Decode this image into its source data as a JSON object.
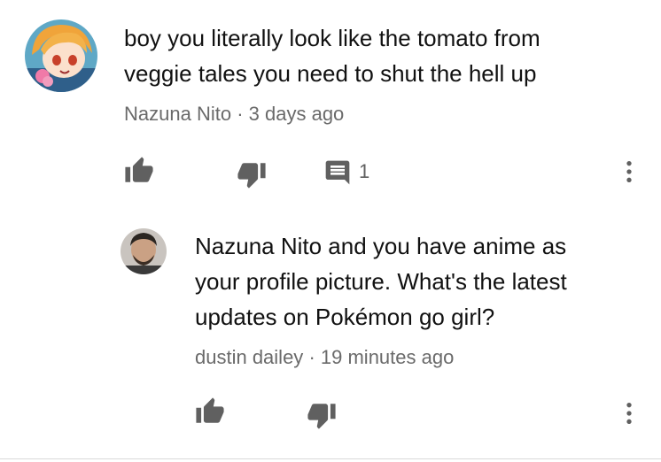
{
  "comment": {
    "text_line1": "boy you literally look like the tomato from",
    "text_line2": "veggie tales you need to shut the hell up",
    "author": "Nazuna Nito",
    "separator": "·",
    "time": "3 days ago",
    "reply_count": "1"
  },
  "reply": {
    "text_line1": "Nazuna Nito and you have anime as",
    "text_line2": "your profile picture. What's the latest",
    "text_line3": "updates on Pokémon go girl?",
    "author": "dustin dailey",
    "separator": "·",
    "time": "19 minutes ago"
  },
  "icons": {
    "like": "thumbs-up-icon",
    "dislike": "thumbs-down-icon",
    "reply": "comment-icon",
    "more": "more-vertical-icon"
  },
  "colors": {
    "icon": "#606060",
    "text": "#111111",
    "meta": "#6a6a6a"
  }
}
